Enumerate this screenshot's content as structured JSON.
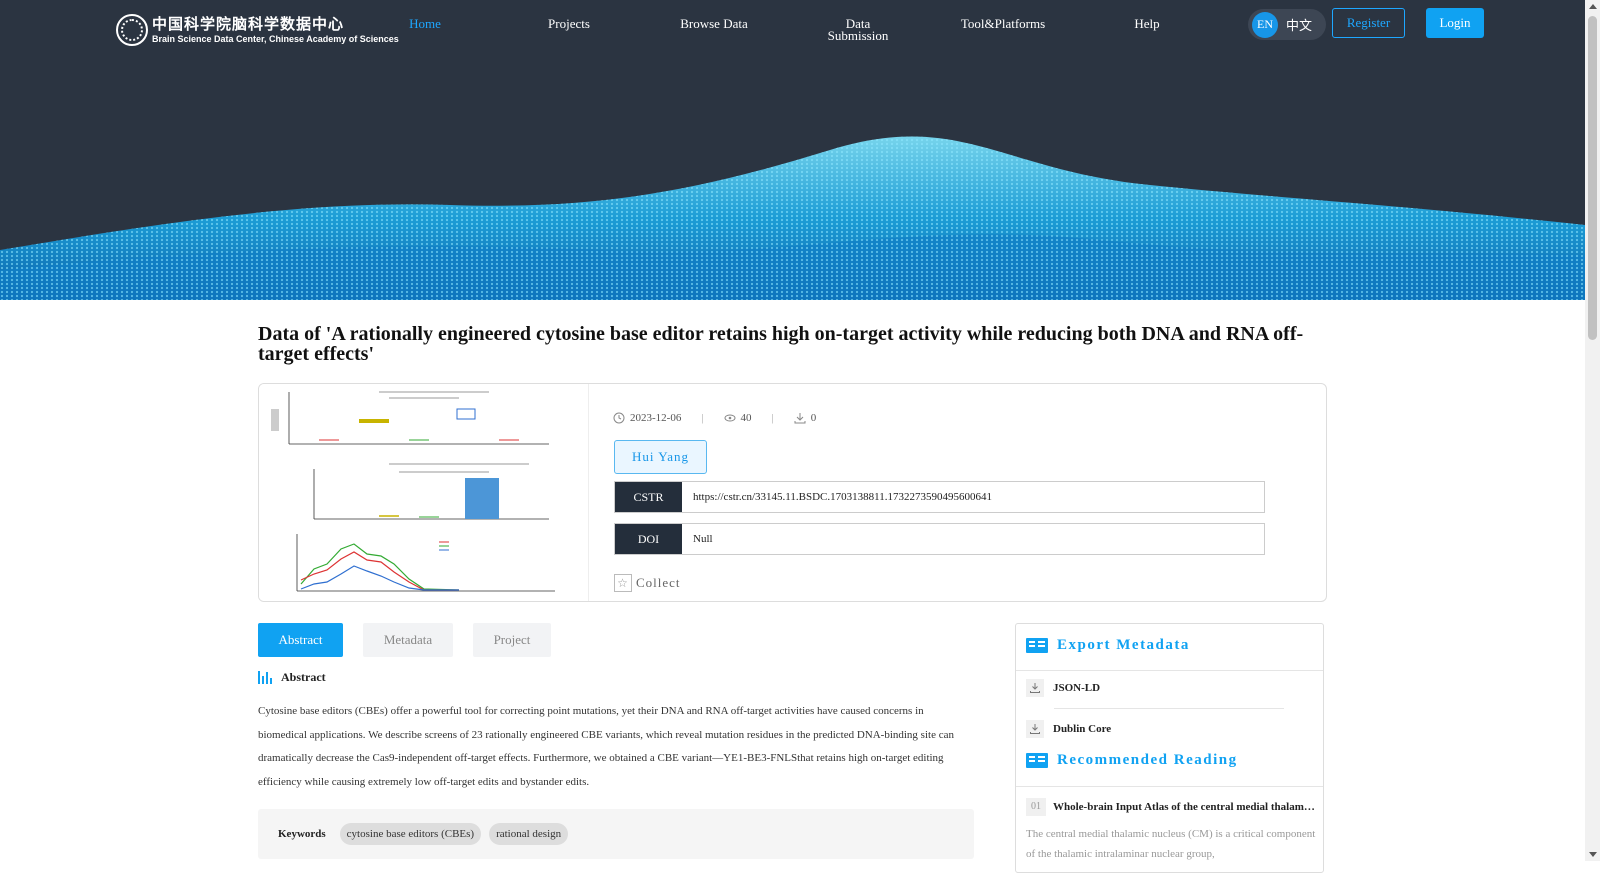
{
  "header": {
    "logo_cn": "中国科学院脑科学数据中心",
    "logo_en": "Brain Science Data Center, Chinese Academy of Sciences",
    "nav": [
      {
        "label": "Home",
        "active": true
      },
      {
        "label": "Projects",
        "active": false
      },
      {
        "label": "Browse Data",
        "active": false
      },
      {
        "label": "Data\nSubmission",
        "active": false
      },
      {
        "label": "Tool&Platforms",
        "active": false
      },
      {
        "label": "Help",
        "active": false
      }
    ],
    "lang_en": "EN",
    "lang_zh": "中文",
    "register_label": "Register",
    "login_label": "Login"
  },
  "dataset": {
    "title": "Data of 'A rationally engineered cytosine base editor retains high on-target activity while reducing both DNA and RNA off-target effects'",
    "date": "2023-12-06",
    "views": "40",
    "downloads": "0",
    "author": "Hui Yang",
    "cstr_label": "CSTR",
    "cstr_value": "https://cstr.cn/33145.11.BSDC.1703138811.1732273590495600641",
    "doi_label": "DOI",
    "doi_value": "Null",
    "collect_label": "Collect"
  },
  "tabs": [
    {
      "label": "Abstract",
      "active": true
    },
    {
      "label": "Metadata",
      "active": false
    },
    {
      "label": "Project",
      "active": false
    }
  ],
  "abstract": {
    "heading": "Abstract",
    "text": "Cytosine base editors (CBEs) offer a powerful tool for correcting point mutations, yet their DNA and RNA off-target activities have caused concerns in biomedical applications. We describe screens of 23 rationally engineered CBE variants, which reveal mutation residues in the predicted DNA-binding site can dramatically decrease the Cas9-independent off-target effects. Furthermore, we obtained a CBE variant—YE1-BE3-FNLSthat retains high on-target editing efficiency while causing extremely low off-target edits and bystander edits."
  },
  "keywords": {
    "label": "Keywords",
    "items": [
      "cytosine base editors (CBEs)",
      "rational design"
    ]
  },
  "sidebar": {
    "export_title": "Export Metadata",
    "export_items": [
      "JSON-LD",
      "Dublin Core"
    ],
    "recommended_title": "Recommended Reading",
    "recommended": [
      {
        "num": "01",
        "title": "Whole-brain Input Atlas of the central medial thalamic nucleus",
        "desc": "The central medial thalamic nucleus (CM) is a critical component of the thalamic intralaminar nuclear group,"
      }
    ]
  },
  "colors": {
    "accent": "#10a2f2",
    "header_bg": "#2b3441",
    "label_bg": "#242e3b"
  }
}
